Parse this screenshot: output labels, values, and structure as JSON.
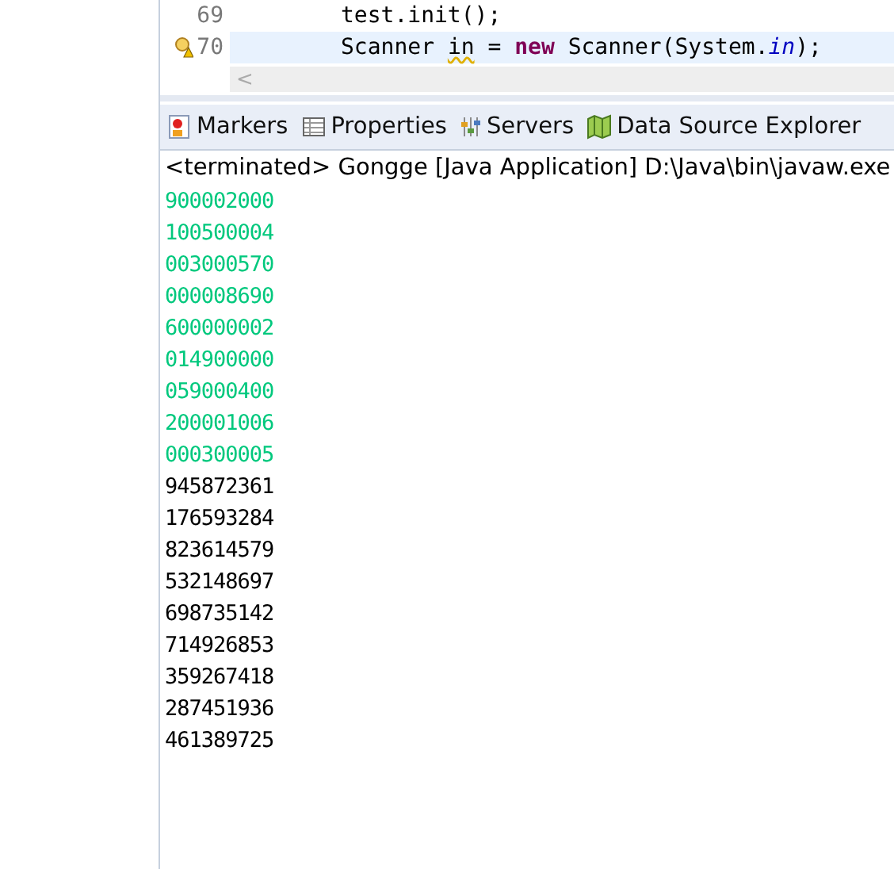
{
  "editor": {
    "lines": [
      {
        "number": "69",
        "code": [
          {
            "text": "test.init();",
            "kind": "plain"
          }
        ],
        "current": false,
        "warning": false
      },
      {
        "number": "70",
        "code": [
          {
            "text": "Scanner ",
            "kind": "plain"
          },
          {
            "text": "in",
            "kind": "warn"
          },
          {
            "text": " = ",
            "kind": "plain"
          },
          {
            "text": "new",
            "kind": "keyword"
          },
          {
            "text": " Scanner(System.",
            "kind": "plain"
          },
          {
            "text": "in",
            "kind": "field"
          },
          {
            "text": ");",
            "kind": "plain"
          }
        ],
        "current": true,
        "warning": true
      }
    ],
    "scroll_arrow": "<"
  },
  "tabs": [
    {
      "label": "Markers",
      "kind": "markers"
    },
    {
      "label": "Properties",
      "kind": "properties"
    },
    {
      "label": "Servers",
      "kind": "servers"
    },
    {
      "label": "Data Source Explorer",
      "kind": "datasource"
    }
  ],
  "console": {
    "header": "<terminated> Gongge [Java Application] D:\\Java\\bin\\javaw.exe",
    "lines": [
      {
        "text": "900002000",
        "kind": "input"
      },
      {
        "text": "100500004",
        "kind": "input"
      },
      {
        "text": "003000570",
        "kind": "input"
      },
      {
        "text": "000008690",
        "kind": "input"
      },
      {
        "text": "600000002",
        "kind": "input"
      },
      {
        "text": "014900000",
        "kind": "input"
      },
      {
        "text": "059000400",
        "kind": "input"
      },
      {
        "text": "200001006",
        "kind": "input"
      },
      {
        "text": "000300005",
        "kind": "input"
      },
      {
        "text": "945872361",
        "kind": "output"
      },
      {
        "text": "176593284",
        "kind": "output"
      },
      {
        "text": "823614579",
        "kind": "output"
      },
      {
        "text": "532148697",
        "kind": "output"
      },
      {
        "text": "698735142",
        "kind": "output"
      },
      {
        "text": "714926853",
        "kind": "output"
      },
      {
        "text": "359267418",
        "kind": "output"
      },
      {
        "text": "287451936",
        "kind": "output"
      },
      {
        "text": "461389725",
        "kind": "output"
      }
    ]
  }
}
